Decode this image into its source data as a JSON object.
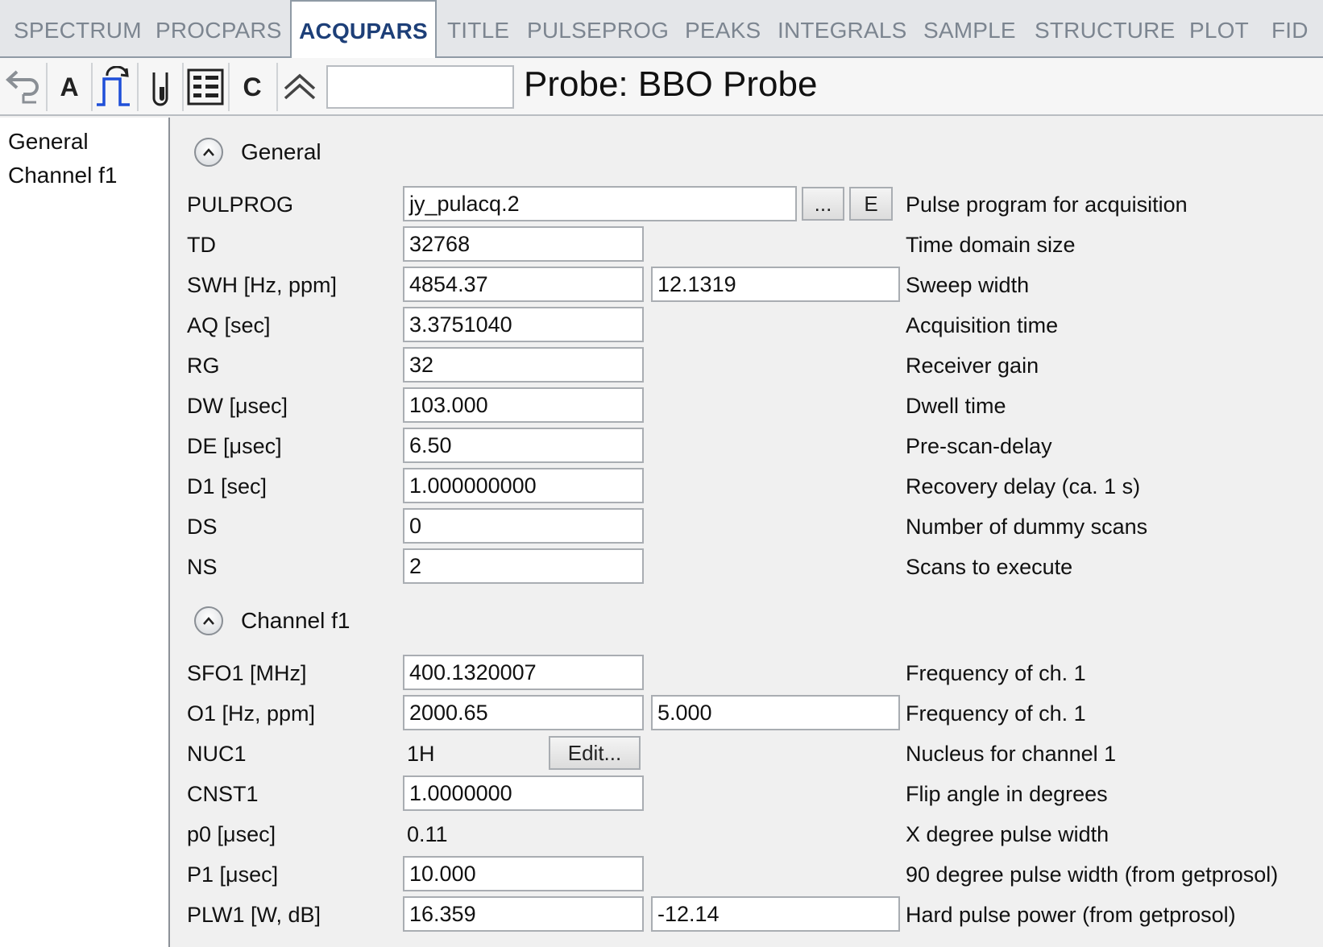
{
  "tabs": [
    {
      "label": "SPECTRUM",
      "active": false
    },
    {
      "label": "PROCPARS",
      "active": false
    },
    {
      "label": "ACQUPARS",
      "active": true
    },
    {
      "label": "TITLE",
      "active": false
    },
    {
      "label": "PULSEPROG",
      "active": false
    },
    {
      "label": "PEAKS",
      "active": false
    },
    {
      "label": "INTEGRALS",
      "active": false
    },
    {
      "label": "SAMPLE",
      "active": false
    },
    {
      "label": "STRUCTURE",
      "active": false
    },
    {
      "label": "PLOT",
      "active": false
    },
    {
      "label": "FID",
      "active": false
    }
  ],
  "toolbar": {
    "icons": [
      "undo-icon",
      "A",
      "pulse-program-icon",
      "sample-tube-icon",
      "parameter-grid-icon",
      "C",
      "collapse-all-icon"
    ],
    "a_label": "A",
    "c_label": "C",
    "search_value": "",
    "probe_label": "Probe: BBO Probe"
  },
  "sidebar": {
    "items": [
      "General",
      "Channel f1"
    ]
  },
  "sections": {
    "general": {
      "title": "General",
      "pulprog": {
        "label": "PULPROG",
        "value": "jy_pulacq.2",
        "browse_label": "...",
        "edit_label": "E",
        "description": "Pulse program for acquisition"
      },
      "td": {
        "label": "TD",
        "value": "32768",
        "description": "Time domain size"
      },
      "swh": {
        "label": "SWH [Hz, ppm]",
        "value_hz": "4854.37",
        "value_ppm": "12.1319",
        "description": "Sweep width"
      },
      "aq": {
        "label": "AQ [sec]",
        "value": "3.3751040",
        "description": "Acquisition time"
      },
      "rg": {
        "label": "RG",
        "value": "32",
        "description": "Receiver gain"
      },
      "dw": {
        "label": "DW [μsec]",
        "value": "103.000",
        "description": "Dwell time"
      },
      "de": {
        "label": "DE [μsec]",
        "value": "6.50",
        "description": "Pre-scan-delay"
      },
      "d1": {
        "label": "D1 [sec]",
        "value": "1.000000000",
        "description": "Recovery delay (ca. 1 s)"
      },
      "ds": {
        "label": "DS",
        "value": "0",
        "description": "Number of dummy scans"
      },
      "ns": {
        "label": "NS",
        "value": "2",
        "description": "Scans to execute"
      }
    },
    "channel_f1": {
      "title": "Channel f1",
      "sfo1": {
        "label": "SFO1 [MHz]",
        "value": "400.1320007",
        "description": "Frequency of ch. 1"
      },
      "o1": {
        "label": "O1 [Hz, ppm]",
        "value_hz": "2000.65",
        "value_ppm": "5.000",
        "description": "Frequency of ch. 1"
      },
      "nuc1": {
        "label": "NUC1",
        "value": "1H",
        "edit_label": "Edit...",
        "description": "Nucleus for channel 1"
      },
      "cnst1": {
        "label": "CNST1",
        "value": "1.0000000",
        "description": "Flip angle in degrees"
      },
      "p0": {
        "label": "p0 [μsec]",
        "value": "0.11",
        "description": "X degree pulse width"
      },
      "p1": {
        "label": "P1 [μsec]",
        "value": "10.000",
        "description": "90 degree pulse width (from getprosol)"
      },
      "plw1": {
        "label": "PLW1 [W, dB]",
        "value_w": "16.359",
        "value_db": "-12.14",
        "description": "Hard pulse power (from getprosol)"
      }
    }
  },
  "colors": {
    "tab_active_text": "#1d3f78",
    "tab_inactive_text": "#7c8590",
    "pulse_icon_blue": "#1f4fd8"
  }
}
